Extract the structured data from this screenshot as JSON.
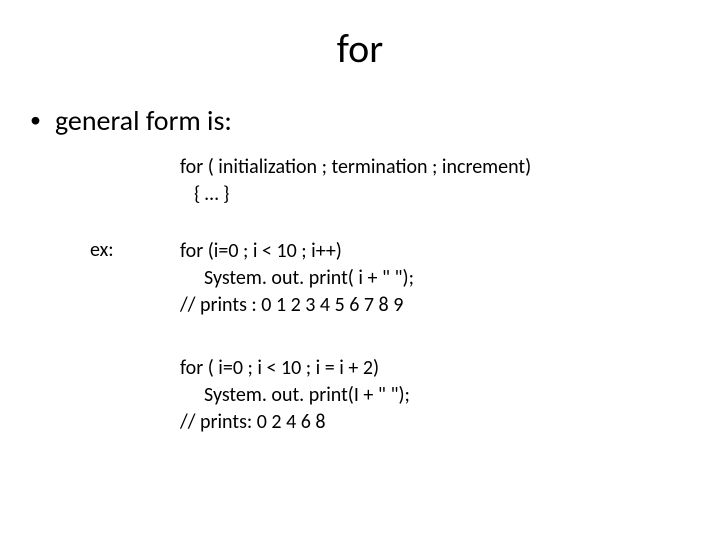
{
  "title": "for",
  "bullet_text": "general form is:",
  "syntax": {
    "line1": "for ( initialization ; termination ; increment)",
    "line2": "{  …   }"
  },
  "ex_label": "ex:",
  "example1": {
    "line1": "for (i=0 ; i < 10 ; i++)",
    "line2": "System. out. print( i + \" \");",
    "line3": "// prints :  0 1 2 3 4 5 6 7 8 9"
  },
  "example2": {
    "line1": "for ( i=0 ; i < 10 ; i = i + 2)",
    "line2": "System. out. print(I + \" \");",
    "line3": "// prints: 0 2 4 6 8"
  }
}
